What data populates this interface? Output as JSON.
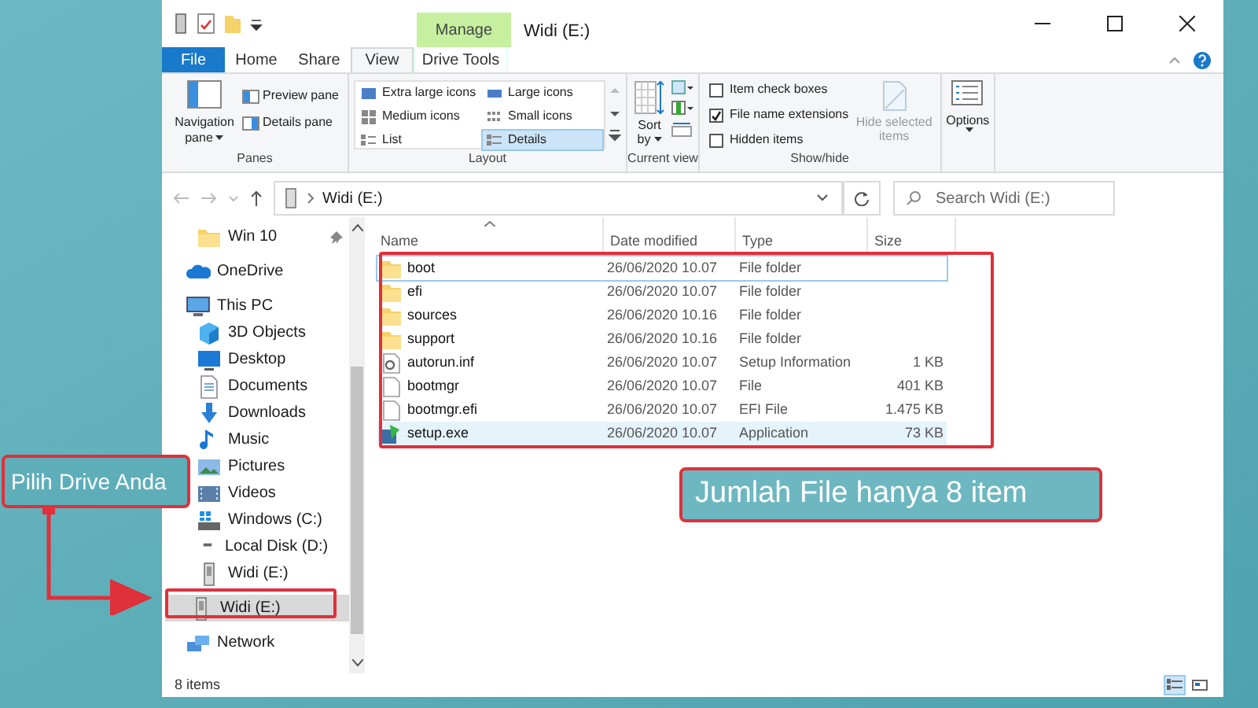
{
  "title_bar": {
    "contextual_label": "Manage",
    "title": "Widi (E:)"
  },
  "tabs": [
    {
      "label": "File",
      "kind": "file",
      "selected": false
    },
    {
      "label": "Home",
      "kind": "normal",
      "selected": false
    },
    {
      "label": "Share",
      "kind": "normal",
      "selected": false
    },
    {
      "label": "View",
      "kind": "normal",
      "selected": true
    },
    {
      "label": "Drive Tools",
      "kind": "contextual",
      "selected": false
    }
  ],
  "ribbon": {
    "panes": {
      "label": "Panes",
      "navigation_pane": "Navigation pane",
      "preview_pane": "Preview pane",
      "details_pane": "Details pane"
    },
    "layout": {
      "label": "Layout",
      "options": [
        {
          "label": "Extra large icons",
          "selected": false
        },
        {
          "label": "Large icons",
          "selected": false
        },
        {
          "label": "Medium icons",
          "selected": false
        },
        {
          "label": "Small icons",
          "selected": false
        },
        {
          "label": "List",
          "selected": false
        },
        {
          "label": "Details",
          "selected": true
        }
      ]
    },
    "current_view": {
      "label": "Current view",
      "sort": "Sort by"
    },
    "show_hide": {
      "label": "Show/hide",
      "checkboxes": [
        {
          "label": "Item check boxes",
          "checked": false
        },
        {
          "label": "File name extensions",
          "checked": true
        },
        {
          "label": "Hidden items",
          "checked": false
        }
      ],
      "hide_selected": {
        "label": "Hide selected items",
        "disabled": true
      }
    },
    "options": {
      "label": "Options"
    }
  },
  "address": {
    "path": "Widi (E:)",
    "search": {
      "placeholder": "Search Widi (E:)"
    }
  },
  "nav": [
    {
      "label": "Win 10",
      "kind": "folder",
      "pinned": true,
      "selected": false
    },
    {
      "label": "OneDrive",
      "kind": "cloud",
      "selected": false
    },
    {
      "label": "This PC",
      "kind": "pc",
      "selected": false,
      "children": [
        {
          "label": "3D Objects",
          "kind": "cube",
          "selected": false
        },
        {
          "label": "Desktop",
          "kind": "desktop",
          "selected": false
        },
        {
          "label": "Documents",
          "kind": "docs",
          "selected": false
        },
        {
          "label": "Downloads",
          "kind": "download",
          "selected": false
        },
        {
          "label": "Music",
          "kind": "music",
          "selected": false
        },
        {
          "label": "Pictures",
          "kind": "pictures",
          "selected": false
        },
        {
          "label": "Videos",
          "kind": "video",
          "selected": false
        },
        {
          "label": "Windows (C:)",
          "kind": "windrive",
          "selected": false
        },
        {
          "label": "Local Disk (D:)",
          "kind": "drive",
          "selected": false
        },
        {
          "label": "Widi (E:)",
          "kind": "usb",
          "selected": false
        }
      ]
    },
    {
      "label": "Widi (E:)",
      "kind": "usb",
      "selected": true
    },
    {
      "label": "Network",
      "kind": "network",
      "selected": false
    }
  ],
  "columns": [
    "Name",
    "Date modified",
    "Type",
    "Size"
  ],
  "rows": [
    {
      "name": "boot",
      "kind": "folder",
      "date": "26/06/2020 10.07",
      "type": "File folder",
      "focused": true,
      "selected": false
    },
    {
      "name": "efi",
      "kind": "folder",
      "date": "26/06/2020 10.07",
      "type": "File folder",
      "focused": false,
      "selected": false
    },
    {
      "name": "sources",
      "kind": "folder",
      "date": "26/06/2020 10.16",
      "type": "File folder",
      "focused": false,
      "selected": false
    },
    {
      "name": "support",
      "kind": "folder",
      "date": "26/06/2020 10.16",
      "type": "File folder",
      "focused": false,
      "selected": false
    },
    {
      "name": "autorun.inf",
      "kind": "settings",
      "date": "26/06/2020 10.07",
      "type": "Setup Information",
      "size": "1 KB",
      "focused": false,
      "selected": false
    },
    {
      "name": "bootmgr",
      "kind": "file",
      "date": "26/06/2020 10.07",
      "type": "File",
      "size": "401 KB",
      "focused": false,
      "selected": false
    },
    {
      "name": "bootmgr.efi",
      "kind": "file",
      "date": "26/06/2020 10.07",
      "type": "EFI File",
      "size": "1.475 KB",
      "focused": false,
      "selected": false
    },
    {
      "name": "setup.exe",
      "kind": "app",
      "date": "26/06/2020 10.07",
      "type": "Application",
      "size": "73 KB",
      "focused": false,
      "selected": true
    }
  ],
  "status_bar": {
    "count": "8 items",
    "views": [
      {
        "kind": "details",
        "selected": true
      },
      {
        "kind": "tiles",
        "selected": false
      }
    ]
  },
  "annotations": [
    {
      "text": "Pilih Drive Anda"
    },
    {
      "text": "Jumlah File hanya 8 item"
    }
  ]
}
